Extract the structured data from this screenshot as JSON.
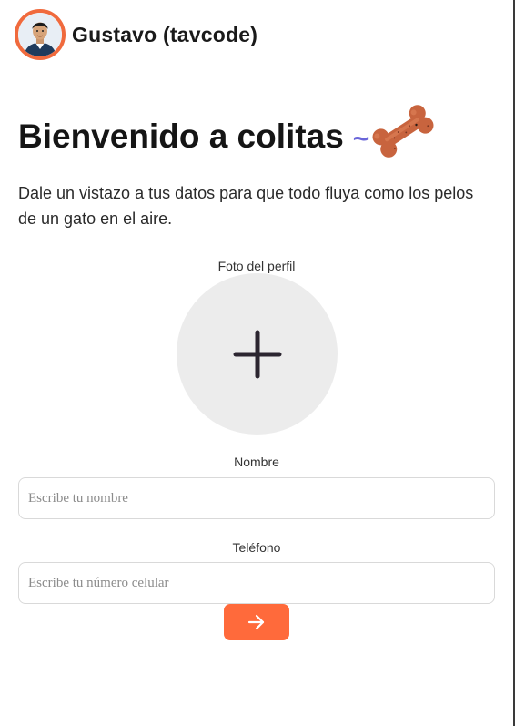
{
  "header": {
    "username": "Gustavo (tavcode)",
    "avatar_icon": "user-photo",
    "accent_color": "#f06a3d"
  },
  "welcome": {
    "title": "Bienvenido a colitas",
    "tilde": "~",
    "bone_icon": "dog-bone-icon",
    "subtitle": "Dale un vistazo a tus datos para que todo fluya como los pelos de un gato en el aire."
  },
  "profile_photo": {
    "label": "Foto del perfil",
    "icon": "plus-icon"
  },
  "form": {
    "name_label": "Nombre",
    "name_placeholder": "Escribe tu nombre",
    "phone_label": "Teléfono",
    "phone_placeholder": "Escribe tu número celular",
    "submit_icon": "arrow-right-icon",
    "button_color": "#ff6a3b"
  }
}
